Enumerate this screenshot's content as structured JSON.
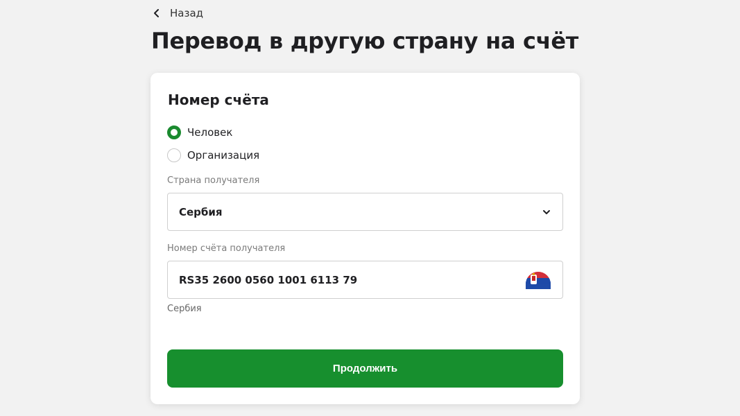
{
  "back": {
    "label": "Назад"
  },
  "page_title": "Перевод в другую страну на счёт",
  "form": {
    "section_title": "Номер счёта",
    "recipient_type": {
      "options": [
        {
          "label": "Человек",
          "selected": true
        },
        {
          "label": "Организация",
          "selected": false
        }
      ]
    },
    "country": {
      "label": "Страна получателя",
      "value": "Сербия"
    },
    "account": {
      "label": "Номер счёта получателя",
      "value": "RS35 2600 0560 1001 6113 79",
      "detected_country": "Сербия",
      "flag_icon": "serbia-flag-icon"
    },
    "submit_label": "Продолжить"
  },
  "colors": {
    "accent_green": "#178f2e",
    "background": "#f2f2f2",
    "card": "#ffffff"
  }
}
